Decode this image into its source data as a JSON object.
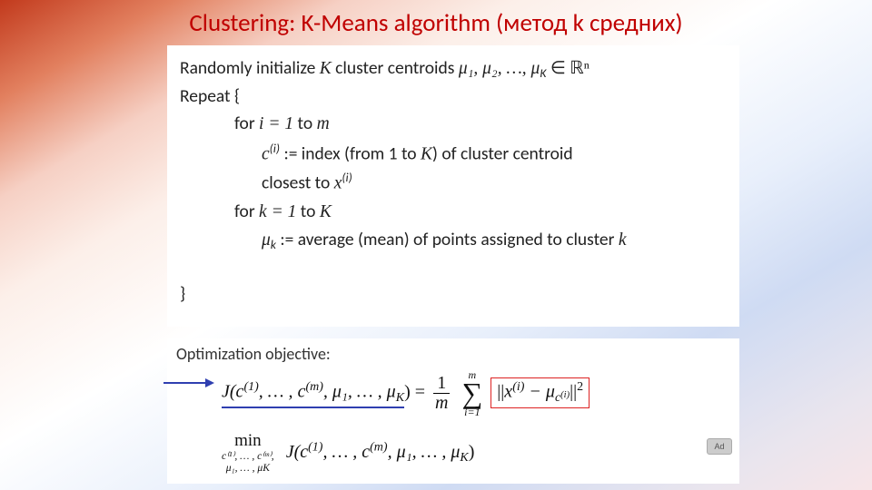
{
  "title": "Clustering: K-Means algorithm (метод k средних)",
  "algorithm": {
    "line1_head": "Randomly initialize ",
    "line1_K": "K",
    "line1_text2": " cluster centroids ",
    "line1_mu_list": "μ₁, μ₂, …, μ",
    "line1_K_sub": "K",
    "line1_in": " ∈ ",
    "line1_Rn": "ℝⁿ",
    "line2": "Repeat {",
    "line3_for": "for ",
    "line3_ieq": "i = 1",
    "line3_to": " to ",
    "line3_m": "m",
    "line4_c": "c",
    "line4_sup_i": "(i)",
    "line4_assign": " := index (from 1 to ",
    "line4_K": "K",
    "line4_rest": ") of cluster centroid",
    "line5_text": "closest to ",
    "line5_x": "x",
    "line5_sup_i": "(i)",
    "line6_for": "for ",
    "line6_keq": "k = 1",
    "line6_to": " to ",
    "line6_K": "K",
    "line7_mu": "μ",
    "line7_sub_k": "k",
    "line7_assign": " := average (mean) of points assigned to cluster ",
    "line7_k": "k",
    "line8": "}"
  },
  "objective": {
    "label": "Optimization objective:",
    "J": "J",
    "args_c": "(c",
    "sup_1": "(1)",
    "dots": ", … , ",
    "c2": "c",
    "sup_m": "(m)",
    "comma_mu": ", μ₁, … , μ",
    "K_sub": "K",
    "close_eq": ") = ",
    "frac_num": "1",
    "frac_den": "m",
    "sigma_top": "m",
    "sigma_bot": "i=1",
    "norm_open": "||",
    "x": "x",
    "sup_i": "(i)",
    "minus": " − μ",
    "sub_c": "c",
    "sub_c_sup": "(i)",
    "norm_close": "||",
    "sq": "2",
    "min_word": "min",
    "min_sub1": "c⁽¹⁾, … , c⁽ᵐ⁾,",
    "min_sub2": "μ₁, … , μK",
    "J2_args": "J(c",
    "ad": "Ad"
  }
}
